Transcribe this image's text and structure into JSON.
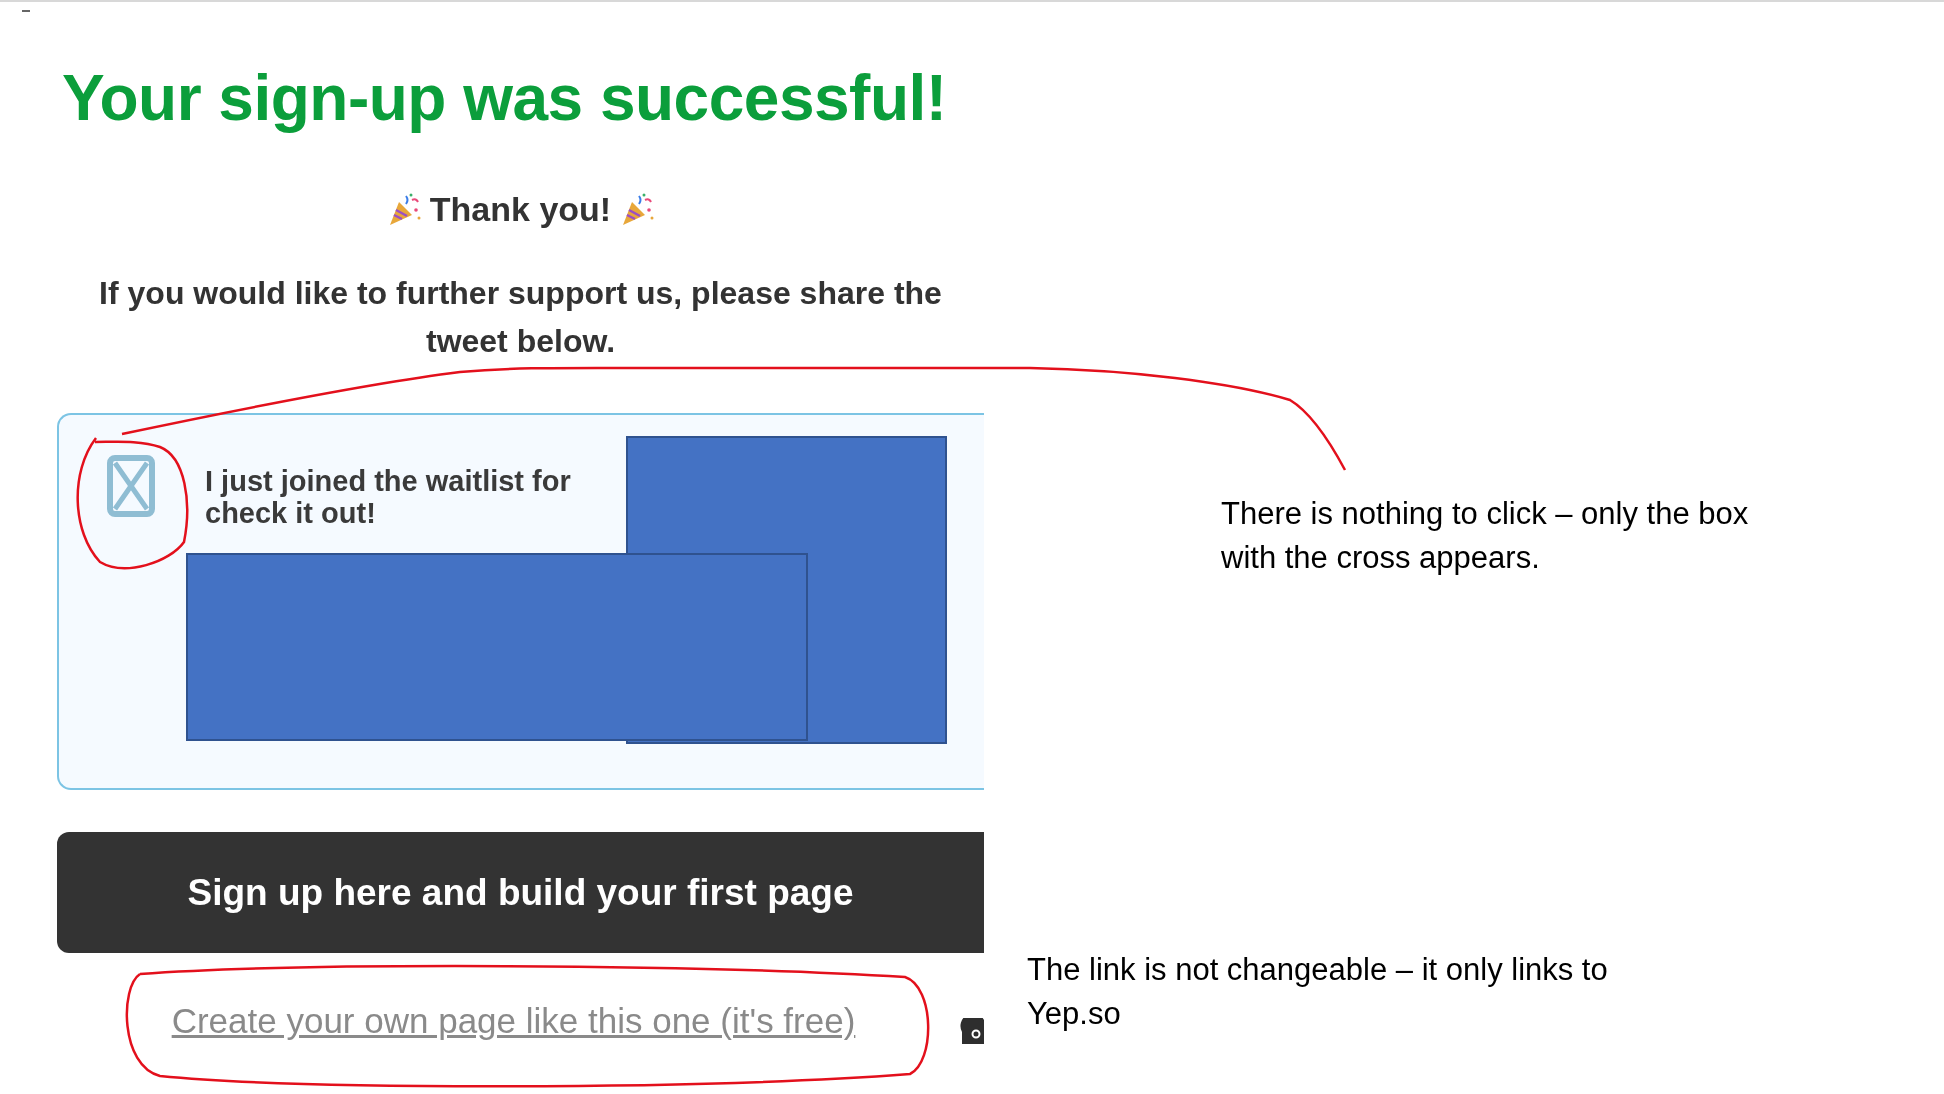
{
  "heading": "Your sign-up was successful!",
  "thank_you": "Thank you!",
  "share_text": "If you would like to further support us, please share the tweet below.",
  "tweet_card": {
    "lines": [
      "I just joined the waitlist for",
      "check it out!"
    ]
  },
  "signup_button": "Sign up here and build your first page",
  "free_link": "Create your own page like this one (it's free)",
  "annotations": [
    {
      "kind": "top",
      "text": "There is nothing to click – only the box with the cross appears."
    },
    {
      "kind": "bottom",
      "text": "The link is not changeable – it only links to Yep.so"
    }
  ]
}
